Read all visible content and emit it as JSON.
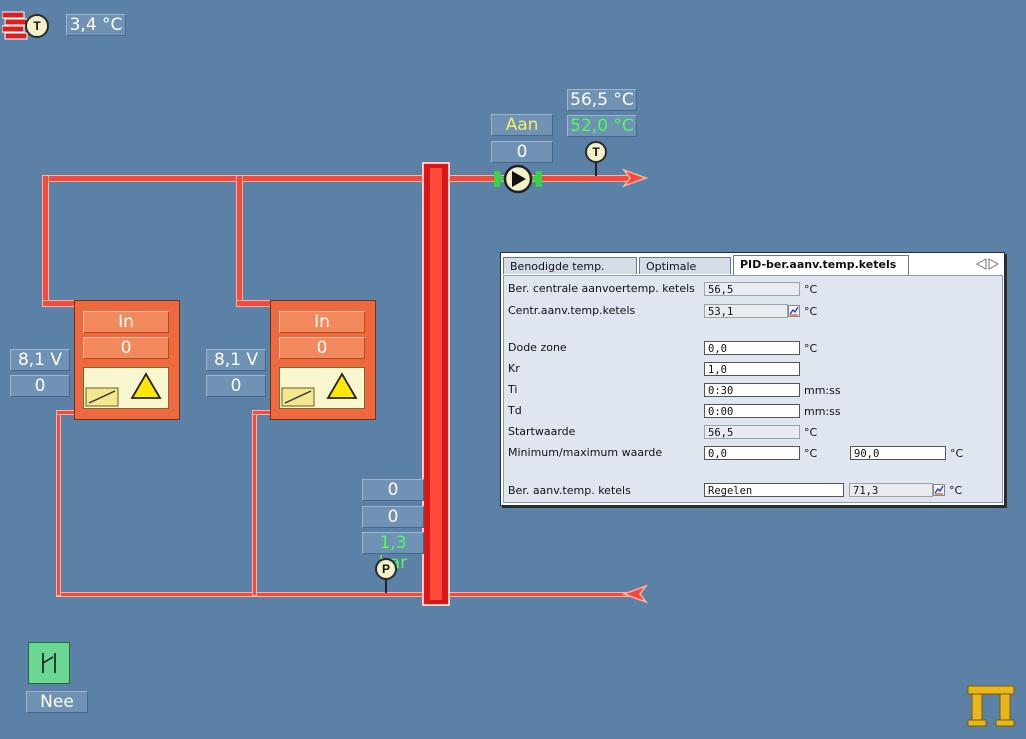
{
  "outside": {
    "temp": "3,4 °C",
    "sensor_label": "T"
  },
  "supply": {
    "temp": "56,5 °C",
    "setpoint": "52,0 °C",
    "pump_status": "Aan",
    "pump_speed": "0",
    "sensor_label": "T"
  },
  "boilers": [
    {
      "status": "In",
      "value": "0",
      "voltage": "8,1 V",
      "count": "0"
    },
    {
      "status": "In",
      "value": "0",
      "voltage": "8,1 V",
      "count": "0"
    }
  ],
  "header": {
    "value1": "0",
    "value2": "0",
    "pressure": "1,3 bar",
    "sensor_label": "P"
  },
  "switch": {
    "label": "Nee"
  },
  "dialog": {
    "tabs": [
      "Benodigde temp. inst.",
      "Optimale start",
      "PID-ber.aanv.temp.ketels"
    ],
    "rows": {
      "ber_centrale": {
        "label": "Ber. centrale aanvoertemp. ketels",
        "value": "56,5",
        "unit": "°C"
      },
      "centr_aanv": {
        "label": "Centr.aanv.temp.ketels",
        "value": "53,1",
        "unit": "°C"
      },
      "dode_zone": {
        "label": "Dode zone",
        "value": "0,0",
        "unit": "°C"
      },
      "kr": {
        "label": "Kr",
        "value": "1,0"
      },
      "ti": {
        "label": "Ti",
        "value": "0:30",
        "unit": "mm:ss"
      },
      "td": {
        "label": "Td",
        "value": "0:00",
        "unit": "mm:ss"
      },
      "startwaarde": {
        "label": "Startwaarde",
        "value": "56,5",
        "unit": "°C"
      },
      "minmax": {
        "label": "Minimum/maximum waarde",
        "min": "0,0",
        "min_unit": "°C",
        "max": "90,0",
        "max_unit": "°C"
      },
      "ber_aanv": {
        "label": "Ber. aanv.temp. ketels",
        "mode": "Regelen",
        "value": "71,3",
        "unit": "°C"
      }
    }
  },
  "colors": {
    "background": "#5b81a6",
    "pipe": "#f24a3c",
    "boiler": "#ee6a3e",
    "green_value": "#4cff5a"
  }
}
